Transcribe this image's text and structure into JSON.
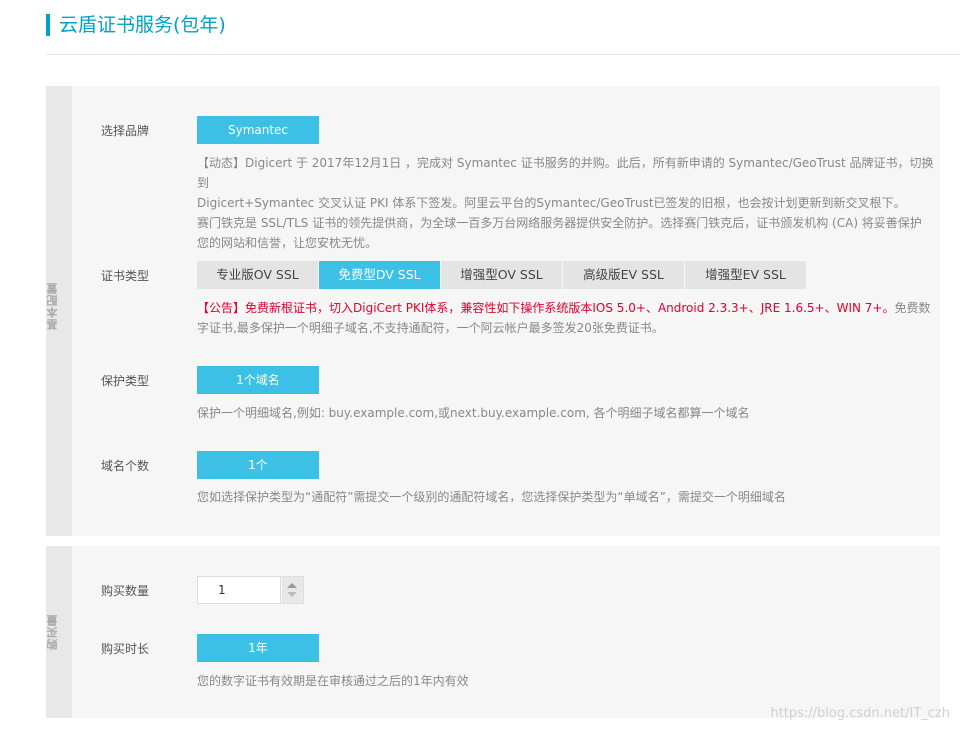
{
  "header": {
    "title": "云盾证书服务(包年)"
  },
  "basic": {
    "side_label": "基本配置",
    "brand": {
      "label": "选择品牌",
      "selected": "Symantec",
      "desc": [
        "【动态】Digicert 于 2017年12月1日 ，完成对 Symantec 证书服务的并购。此后，所有新申请的 Symantec/GeoTrust 品牌证书，切换到",
        "Digicert+Symantec 交叉认证 PKI 体系下签发。阿里云平台的Symantec/GeoTrust已签发的旧根，也会按计划更新到新交叉根下。",
        "赛门铁克是 SSL/TLS 证书的领先提供商，为全球一百多万台网络服务器提供安全防护。选择赛门铁克后，证书颁发机构 (CA) 将妥善保护",
        "您的网站和信誉，让您安枕无忧。"
      ]
    },
    "cert_type": {
      "label": "证书类型",
      "tabs": [
        "专业版OV SSL",
        "免费型DV SSL",
        "增强型OV SSL",
        "高级版EV SSL",
        "增强型EV SSL"
      ],
      "notice_red": "【公告】免费新根证书，切入DigiCert PKI体系，兼容性如下操作系统版本IOS 5.0+、Android 2.3.3+、JRE 1.6.5+、WIN 7+。",
      "notice_gray": "免费数字证书,最多保护一个明细子域名,不支持通配符，一个阿云帐户最多签发20张免费证书。"
    },
    "protect_type": {
      "label": "保护类型",
      "selected": "1个域名",
      "desc": "保护一个明细域名,例如: buy.example.com,或next.buy.example.com, 各个明细子域名都算一个域名"
    },
    "domain_count": {
      "label": "域名个数",
      "selected": "1个",
      "desc": "您如选择保护类型为“通配符”需提交一个级别的通配符域名，您选择保护类型为“单域名”，需提交一个明细域名"
    }
  },
  "buy": {
    "side_label": "购买量",
    "quantity": {
      "label": "购买数量",
      "value": "1"
    },
    "duration": {
      "label": "购买时长",
      "selected": "1年",
      "desc": "您的数字证书有效期是在审核通过之后的1年内有效"
    }
  },
  "watermark": "https://blog.csdn.net/IT_czh",
  "colors": {
    "accent": "#3cc0e6",
    "title": "#00a2ca",
    "notice_red": "#e4002b"
  }
}
